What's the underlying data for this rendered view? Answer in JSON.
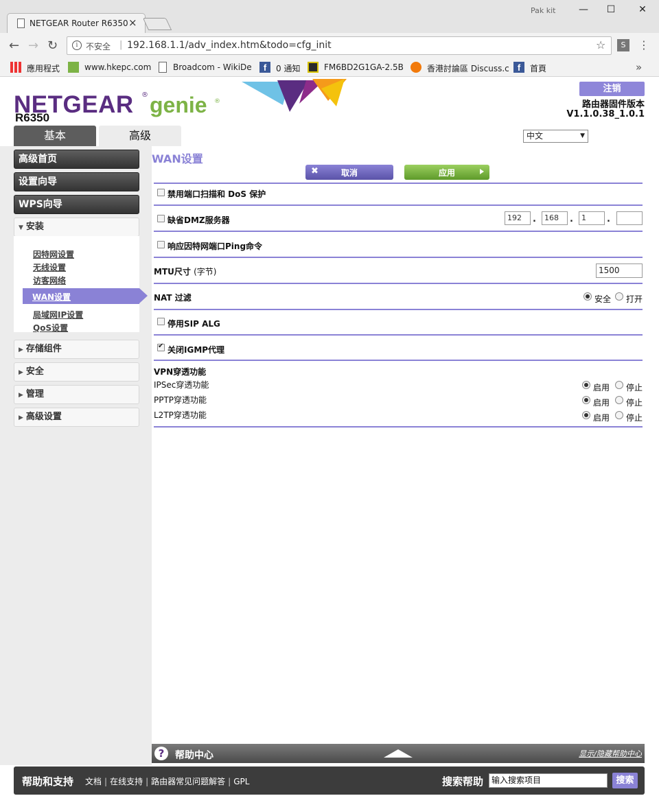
{
  "browser": {
    "tab_title": "NETGEAR Router R6350",
    "user": "Pak kit",
    "security_label": "不安全",
    "url": "192.168.1.1/adv_index.htm&todo=cfg_init",
    "bookmarks": [
      {
        "label": "應用程式",
        "icon": "apps-icon"
      },
      {
        "label": "www.hkepc.com",
        "icon": "hkepc-icon"
      },
      {
        "label": "Broadcom - WikiDe",
        "icon": "page-icon"
      },
      {
        "label": "0 通知",
        "icon": "facebook-icon"
      },
      {
        "label": "FM6BD2G1GA-2.5B",
        "icon": "fm-icon"
      },
      {
        "label": "香港討論區 Discuss.c",
        "icon": "discuss-icon"
      },
      {
        "label": "首頁",
        "icon": "facebook-icon"
      }
    ]
  },
  "header": {
    "brand": "NETGEAR",
    "product": "genie",
    "model": "R6350",
    "logout": "注销",
    "fw_label": "路由器固件版本",
    "fw_version": "V1.1.0.38_1.0.1",
    "tab_basic": "基本",
    "tab_advanced": "高级",
    "language": "中文"
  },
  "sidebar": {
    "main": [
      "高级首页",
      "设置向导",
      "WPS向导"
    ],
    "install": "安装",
    "install_items": [
      "因特网设置",
      "无线设置",
      "访客网络",
      "WAN设置",
      "局域网IP设置",
      "QoS设置"
    ],
    "sections": [
      "存储组件",
      "安全",
      "管理",
      "高级设置"
    ]
  },
  "main": {
    "title": "WAN设置",
    "cancel": "取消",
    "apply": "应用",
    "dos": {
      "label": "禁用端口扫描和 DoS 保护",
      "checked": false
    },
    "dmz": {
      "label": "缺省DMZ服务器",
      "checked": false,
      "ip": [
        "192",
        "168",
        "1",
        ""
      ]
    },
    "ping": {
      "label": "响应因特网端口Ping命令",
      "checked": false
    },
    "mtu": {
      "label": "MTU尺寸",
      "unit": "(字节)",
      "value": "1500"
    },
    "nat": {
      "label": "NAT 过滤",
      "opt_secure": "安全",
      "opt_open": "打开",
      "selected": "安全"
    },
    "sip": {
      "label": "停用SIP ALG",
      "checked": false
    },
    "igmp": {
      "label": "关闭IGMP代理",
      "checked": true
    },
    "vpn": {
      "title": "VPN穿透功能",
      "on": "启用",
      "off": "停止",
      "rows": [
        {
          "label": "IPSec穿透功能",
          "selected": "启用"
        },
        {
          "label": "PPTP穿透功能",
          "selected": "启用"
        },
        {
          "label": "L2TP穿透功能",
          "selected": "启用"
        }
      ]
    }
  },
  "help": {
    "title": "帮助中心",
    "toggle": "显示/隐藏帮助中心"
  },
  "footer": {
    "title": "帮助和支持",
    "links": [
      "文档",
      "在线支持",
      "路由器常见问题解答",
      "GPL"
    ],
    "search_title": "搜索帮助",
    "search_value": "输入搜索项目",
    "search_button": "搜索"
  },
  "colors": {
    "brand_purple": "#5a2d81",
    "accent": "#8a82d6",
    "genie_green": "#7db346"
  }
}
